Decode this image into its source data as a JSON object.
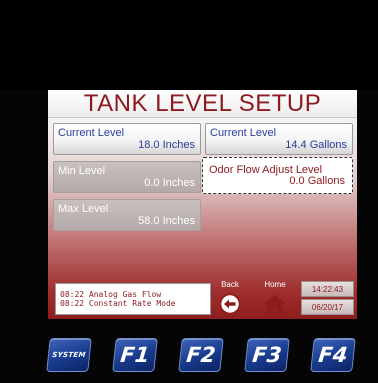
{
  "screen": {
    "title": "TANK LEVEL SETUP",
    "fields": {
      "current_level_inches": {
        "label": "Current Level",
        "value": "18.0 Inches"
      },
      "current_level_gallons": {
        "label": "Current Level",
        "value": "14.4 Gallons"
      },
      "min_level": {
        "label": "Min Level",
        "value": "0.0 Inches"
      },
      "odor_flow_adjust": {
        "label": "Odor Flow Adjust Level",
        "value": "0.0 Gallons"
      },
      "max_level": {
        "label": "Max Level",
        "value": "58.0 Inches"
      }
    },
    "status_messages": [
      "08:22 Analog Gas Flow",
      "08:22 Constant Rate Mode"
    ],
    "nav": {
      "back_label": "Back",
      "home_label": "Home"
    },
    "clock": {
      "time": "14:22:43",
      "date": "06/20/17"
    }
  },
  "function_keys": [
    {
      "label": "SYSTEM",
      "icon": "system-key"
    },
    {
      "label": "F1"
    },
    {
      "label": "F2"
    },
    {
      "label": "F3"
    },
    {
      "label": "F4"
    }
  ],
  "colors": {
    "title_red": "#8c1a1f",
    "value_blue": "#2b3d9c",
    "key_blue": "#183a8c"
  }
}
